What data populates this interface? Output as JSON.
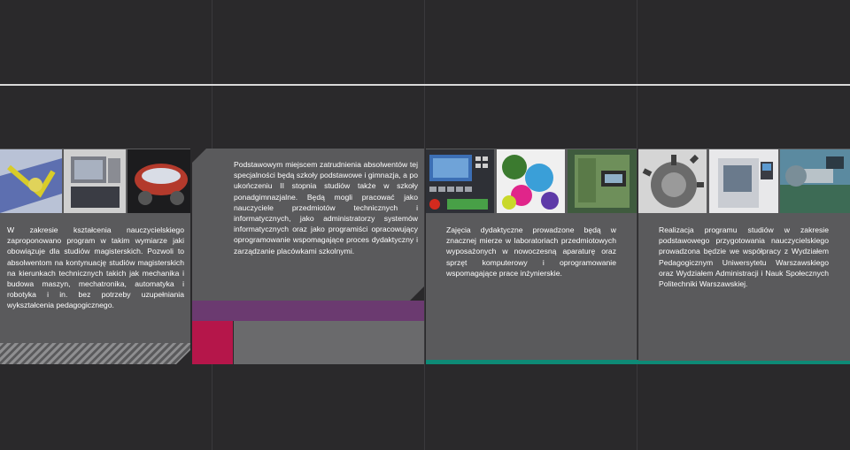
{
  "colors": {
    "background": "#2a292b",
    "panel": "#5a5a5c",
    "purple": "#6b3a70",
    "red": "#b5164a",
    "teal": "#0e8a76"
  },
  "text": {
    "col1": "W zakresie kształcenia nauczycielskiego zaproponowano program w takim wymiarze jaki obowiązuje dla studiów magisterskich. Pozwoli to absolwentom na kontynuację studiów magisterskich na kierunkach technicznych takich jak mechanika i budowa maszyn, mechatronika, automatyka i robotyka i in. bez potrzeby uzupełniania wykształcenia pedagogicznego.",
    "col2": "Podstawowym miejscem zatrudnienia absolwentów tej specjalności będą szkoły podstawowe i gimnazja, a po ukończeniu II stopnia studiów także w szkoły ponadgimnazjalne. Będą mogli pracować jako nauczyciele przedmiotów technicznych i informatycznych, jako administratorzy systemów informatycznych oraz jako programiści opracowujący oprogramowanie wspomagające proces dydaktyczny i zarządzanie placówkami szkolnymi.",
    "col3": "Zajęcia dydaktyczne prowadzone będą w znacznej mierze w laboratoriach przedmiotowych wyposażonych w nowoczesną aparaturę oraz sprzęt komputerowy i oprogramowanie wspomagające prace inżynierskie.",
    "col4": "Realizacja programu studiów w zakresie podstawowego przygotowania nauczycielskiego prowadzona będzie we współpracy z Wydziałem Pedagogicznym Uniwersytetu Warszawskiego oraz Wydziałem Administracji i Nauk Społecznych Politechniki Warszawskiej."
  }
}
